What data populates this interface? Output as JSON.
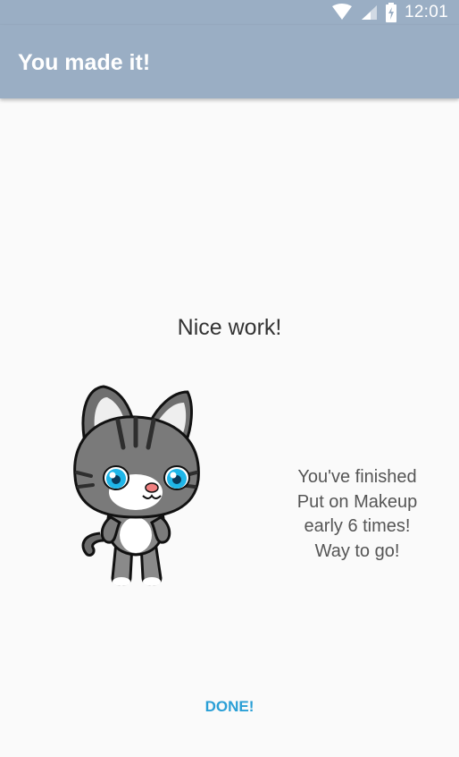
{
  "status_bar": {
    "time": "12:01",
    "icons": [
      "wifi-icon",
      "cell-signal-icon",
      "battery-charging-icon"
    ]
  },
  "app_bar": {
    "title": "You made it!",
    "background": "#9aaec4"
  },
  "content": {
    "headline": "Nice work!",
    "message_lines": [
      "You've finished",
      "Put on Makeup",
      "early 6 times!",
      "Way to go!"
    ],
    "illustration": "cat-mascot"
  },
  "actions": {
    "done_label": "DONE!",
    "accent_color": "#2a9fd6"
  }
}
